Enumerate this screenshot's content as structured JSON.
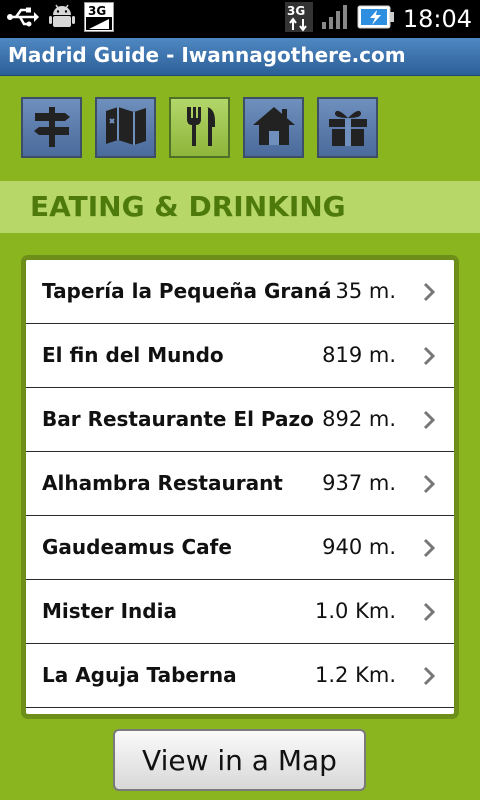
{
  "statusbar": {
    "icons": [
      "usb-icon",
      "android-icon",
      "3g-signal-icon",
      "3g-data-icon",
      "cell-signal-icon",
      "battery-charging-icon"
    ],
    "badge_3g": "3G",
    "network_3g": "3G",
    "time": "18:04"
  },
  "app": {
    "title": "Madrid Guide - Iwannagothere.com"
  },
  "tabs": [
    {
      "icon": "signpost-icon",
      "active": false
    },
    {
      "icon": "map-icon",
      "active": false
    },
    {
      "icon": "fork-knife-icon",
      "active": true
    },
    {
      "icon": "house-icon",
      "active": false
    },
    {
      "icon": "gift-icon",
      "active": false
    }
  ],
  "section": {
    "title": "EATING & DRINKING"
  },
  "places": [
    {
      "name": "Tapería la Pequeña Graná",
      "distance": "35 m."
    },
    {
      "name": "El fin del Mundo",
      "distance": "819 m."
    },
    {
      "name": "Bar Restaurante El Pazo",
      "distance": "892 m."
    },
    {
      "name": "Alhambra Restaurant",
      "distance": "937 m."
    },
    {
      "name": "Gaudeamus Cafe",
      "distance": "940 m."
    },
    {
      "name": "Mister India",
      "distance": "1.0 Km."
    },
    {
      "name": "La Aguja Taberna",
      "distance": "1.2 Km."
    }
  ],
  "actions": {
    "map_button": "View in a Map"
  },
  "colors": {
    "background": "#8bb51e",
    "section_band": "#b7d869",
    "section_text": "#4e7a0c",
    "titlebar": "#3a72ad"
  }
}
